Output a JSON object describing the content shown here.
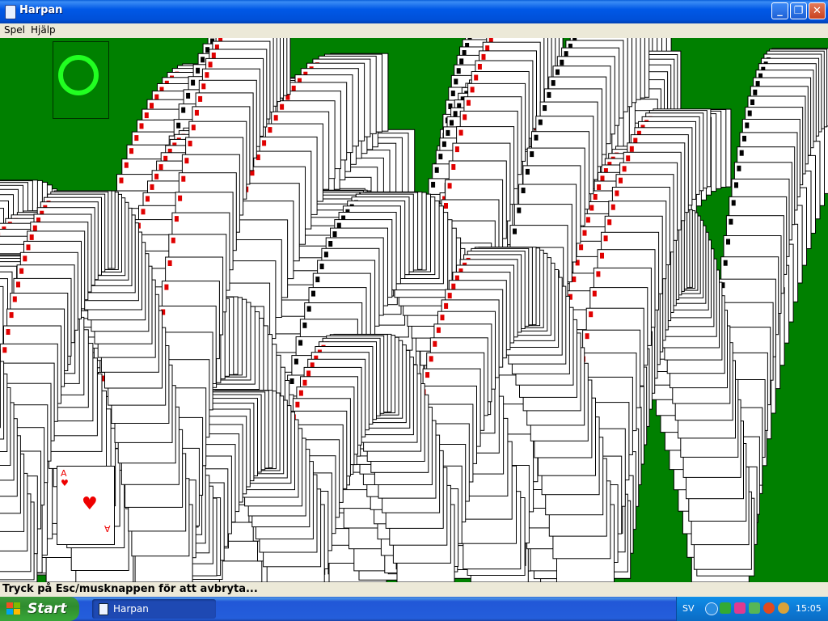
{
  "window": {
    "title": "Harpan"
  },
  "menu": {
    "items": [
      {
        "label": "Spel"
      },
      {
        "label": "Hjälp"
      }
    ]
  },
  "game": {
    "front_card": {
      "rank": "A",
      "suit": "♥"
    }
  },
  "status": {
    "text": "Tryck på Esc/musknappen för att avbryta..."
  },
  "taskbar": {
    "start_label": "Start",
    "task_label": "Harpan",
    "language": "SV",
    "clock": "15:05"
  },
  "colors": {
    "felt": "#008000",
    "accent": "#21ff21",
    "red_suit": "#e00000"
  }
}
